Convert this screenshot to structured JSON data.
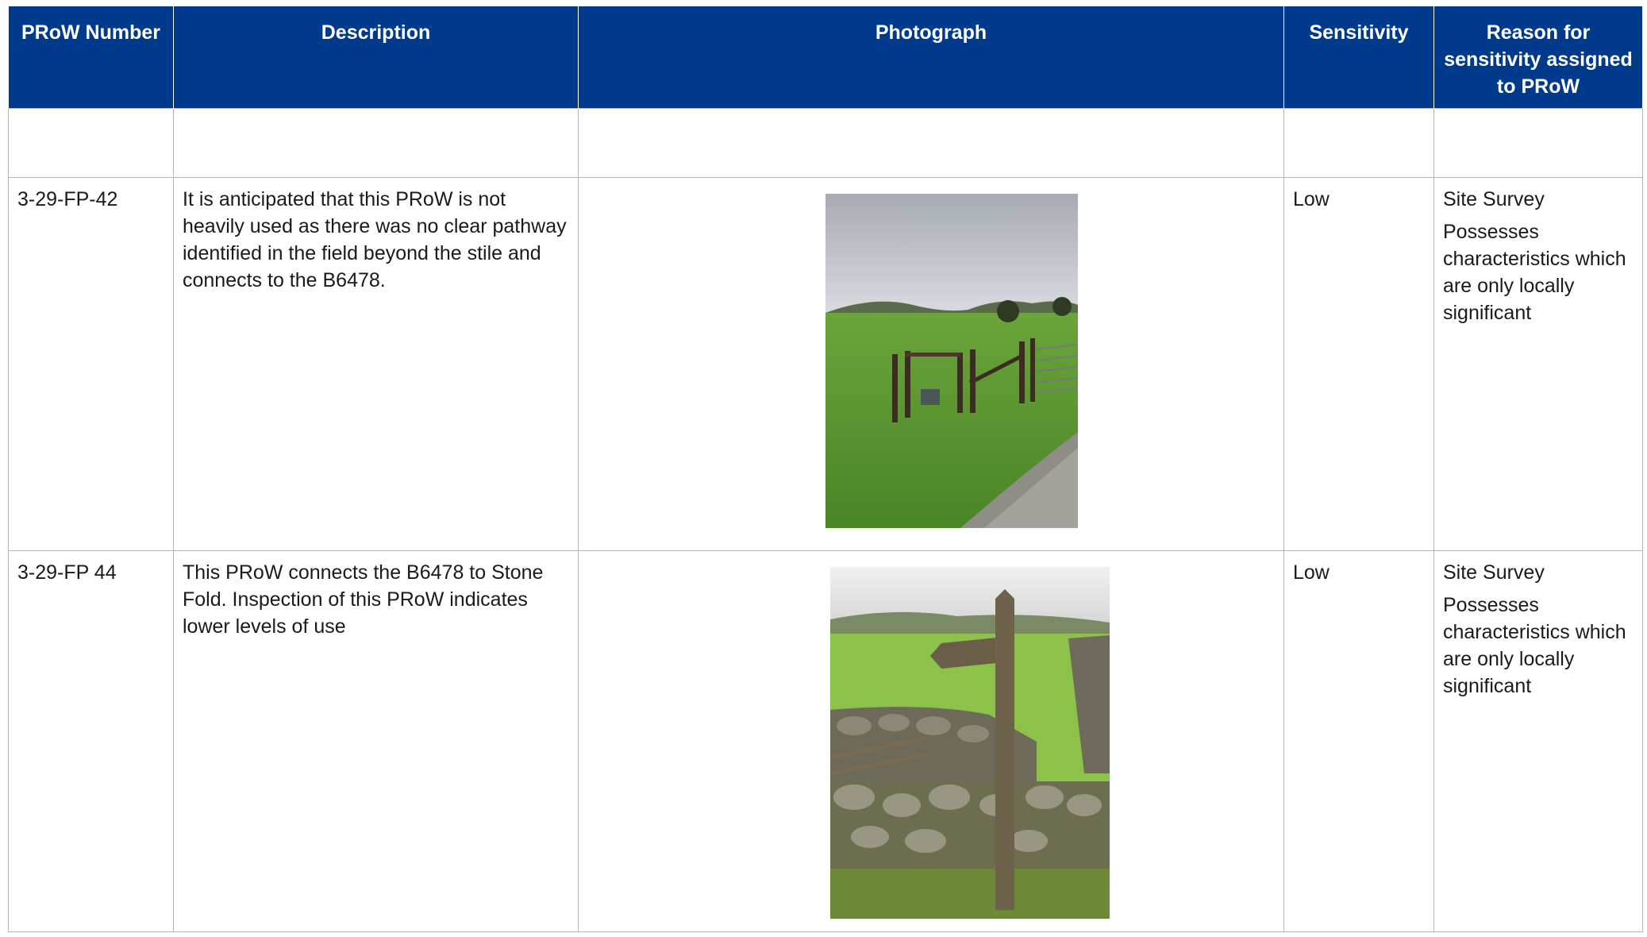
{
  "header": {
    "col_prow": "PRoW Number",
    "col_description": "Description",
    "col_photograph": "Photograph",
    "col_sensitivity": "Sensitivity",
    "col_reason": "Reason for sensitivity assigned to PRoW"
  },
  "rows": [
    {
      "prow": "3-29-FP-42",
      "description": "It is anticipated that this PRoW is not heavily used as there was no clear pathway identified in the field beyond the stile and connects to the B6478.",
      "sensitivity": "Low",
      "reason_source": "Site Survey",
      "reason_text": "Possesses characteristics which are only locally significant",
      "photo": "field-stile-gate-track"
    },
    {
      "prow": "3-29-FP 44",
      "description": "This PRoW connects the B6478 to Stone Fold.  Inspection of this PRoW indicates lower levels of use",
      "sensitivity": "Low",
      "reason_source": "Site Survey",
      "reason_text": "Possesses characteristics which are only locally significant",
      "photo": "fingerpost-dry-stone-wall"
    }
  ],
  "colors": {
    "header_bg": "#003a8c",
    "header_text": "#ffffff",
    "grid": "#b5b5b5"
  }
}
